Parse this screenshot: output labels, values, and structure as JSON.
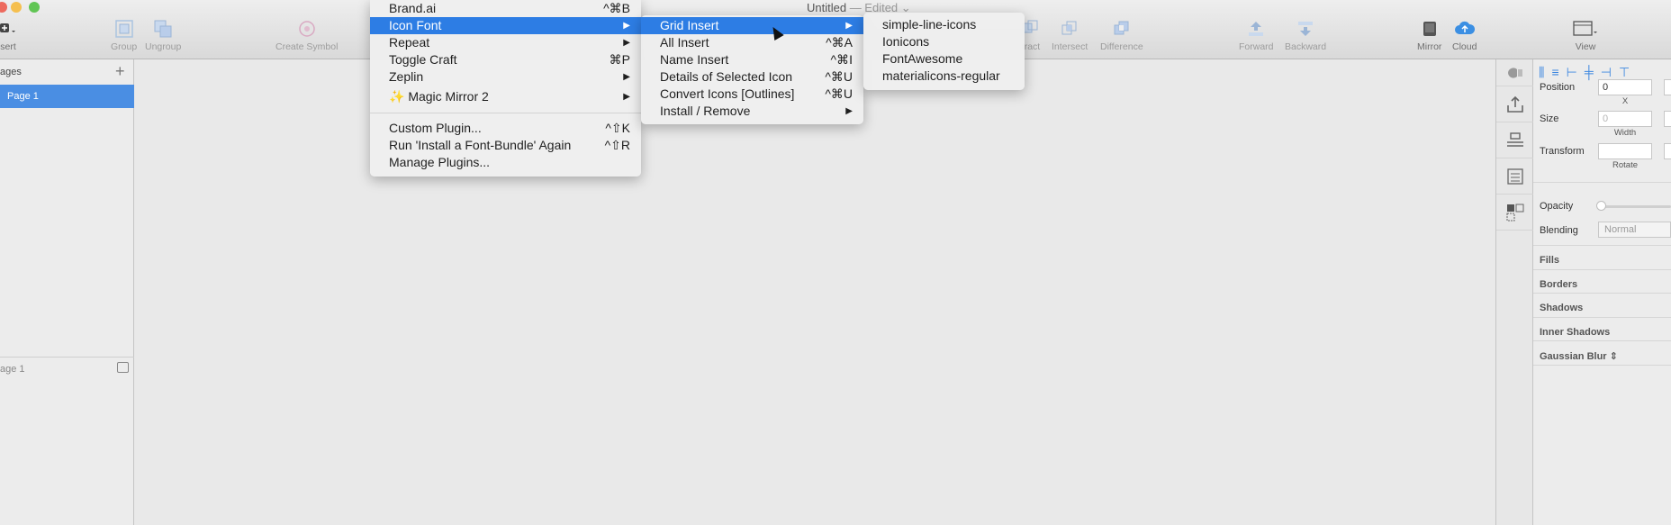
{
  "window": {
    "title": "Untitled",
    "edited": " — Edited ⌄"
  },
  "toolbar": {
    "insert_label": "sert",
    "group_label": "Group",
    "ungroup_label": "Ungroup",
    "create_symbol_label": "Create Symbol",
    "subtract_label": "tract",
    "intersect_label": "Intersect",
    "difference_label": "Difference",
    "forward_label": "Forward",
    "backward_label": "Backward",
    "mirror_label": "Mirror",
    "cloud_label": "Cloud",
    "view_label": "View"
  },
  "pages_panel": {
    "header": "ages",
    "add": "+",
    "pages": [
      "Page 1"
    ],
    "layers_header": "age 1"
  },
  "plugins_menu": {
    "items": [
      {
        "label": "Brand.ai",
        "shortcut": "^⌘B"
      },
      {
        "label": "Icon Font",
        "arrow": "▶"
      },
      {
        "label": "Repeat",
        "arrow": "▶"
      },
      {
        "label": "Toggle Craft",
        "shortcut": "⌘P"
      },
      {
        "label": "Zeplin",
        "arrow": "▶"
      },
      {
        "label": "✨ Magic Mirror 2",
        "arrow": "▶"
      },
      {
        "label": "Custom Plugin...",
        "shortcut": "^⇧K"
      },
      {
        "label": "Run 'Install a Font-Bundle' Again",
        "shortcut": "^⇧R"
      },
      {
        "label": "Manage Plugins..."
      }
    ]
  },
  "icon_font_menu": {
    "items": [
      {
        "label": "Grid Insert",
        "arrow": "▶"
      },
      {
        "label": "All Insert",
        "shortcut": "^⌘A"
      },
      {
        "label": "Name Insert",
        "shortcut": "^⌘I"
      },
      {
        "label": "Details of Selected Icon",
        "shortcut": "^⌘U"
      },
      {
        "label": "Convert Icons [Outlines]",
        "shortcut": "^⌘U"
      },
      {
        "label": "Install / Remove",
        "arrow": "▶"
      }
    ]
  },
  "grid_insert_menu": {
    "items": [
      {
        "label": "simple-line-icons"
      },
      {
        "label": "Ionicons"
      },
      {
        "label": "FontAwesome"
      },
      {
        "label": "materialicons-regular"
      }
    ]
  },
  "inspector": {
    "position_label": "Position",
    "position_x": "0",
    "x_label": "X",
    "size_label": "Size",
    "width_value": "0",
    "width_label": "Width",
    "transform_label": "Transform",
    "rotate_label": "Rotate",
    "opacity_label": "Opacity",
    "blending_label": "Blending",
    "blending_value": "Normal",
    "sections": [
      "Fills",
      "Borders",
      "Shadows",
      "Inner Shadows",
      "Gaussian Blur ⇕"
    ]
  }
}
